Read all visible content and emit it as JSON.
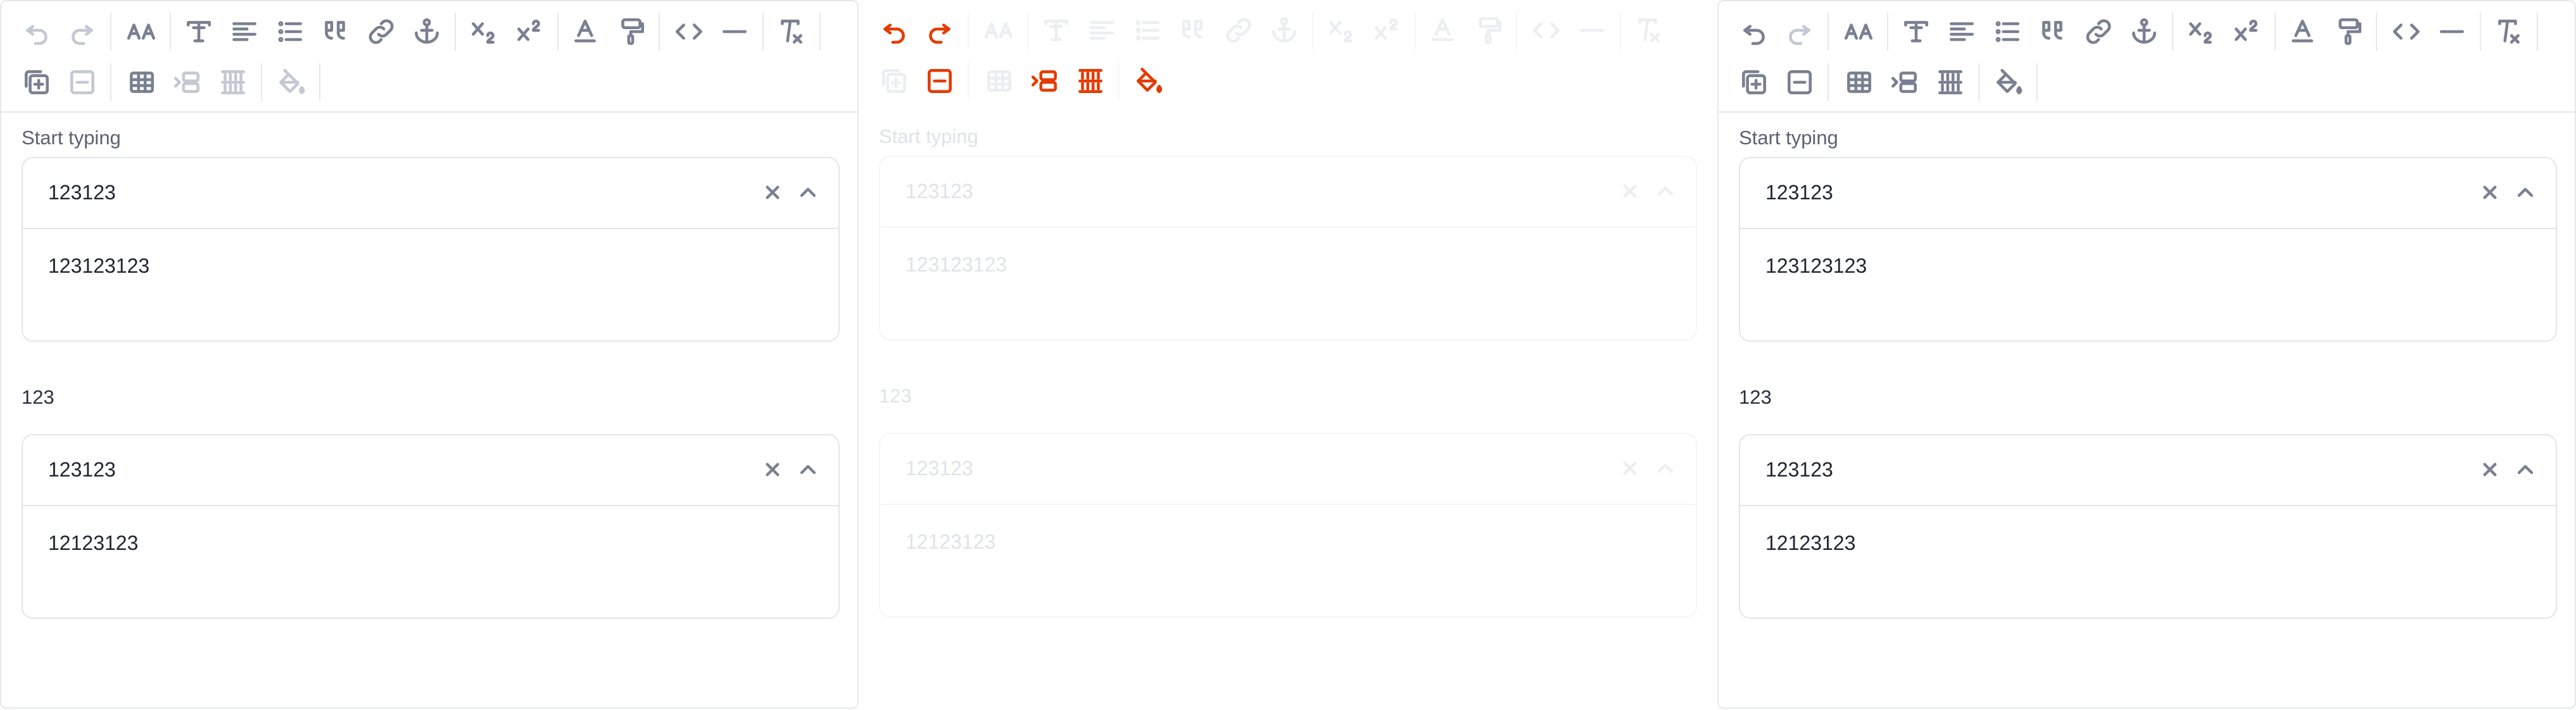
{
  "editors": [
    {
      "id": "left",
      "fields": [
        {
          "label": "Start typing",
          "selected_value": "123123",
          "content": "123123123"
        },
        {
          "label": "123",
          "selected_value": "123123",
          "content": "12123123"
        }
      ]
    },
    {
      "id": "middle",
      "fields": [
        {
          "label": "Start typing",
          "selected_value": "123123",
          "content": "123123123"
        },
        {
          "label": "123",
          "selected_value": "123123",
          "content": "12123123"
        }
      ]
    },
    {
      "id": "right",
      "fields": [
        {
          "label": "Start typing",
          "selected_value": "123123",
          "content": "123123123"
        },
        {
          "label": "123",
          "selected_value": "123123",
          "content": "12123123"
        }
      ]
    }
  ],
  "toolbar_icons": {
    "row1": [
      "undo-icon",
      "redo-icon",
      "font-size-icon",
      "heading-icon",
      "align-icon",
      "bullet-list-icon",
      "quote-icon",
      "link-icon",
      "anchor-icon",
      "subscript-icon",
      "superscript-icon",
      "text-color-icon",
      "format-painter-icon",
      "code-icon",
      "horizontal-rule-icon",
      "clear-format-icon"
    ],
    "row2": [
      "insert-row-icon",
      "delete-row-icon",
      "table-icon",
      "insert-column-icon",
      "delete-column-icon",
      "cell-fill-icon"
    ]
  },
  "colors": {
    "icon_active": "#7a8091",
    "icon_disabled": "#c4c8d2",
    "highlight_red": "#e43b00",
    "border": "#e3e5eb"
  }
}
